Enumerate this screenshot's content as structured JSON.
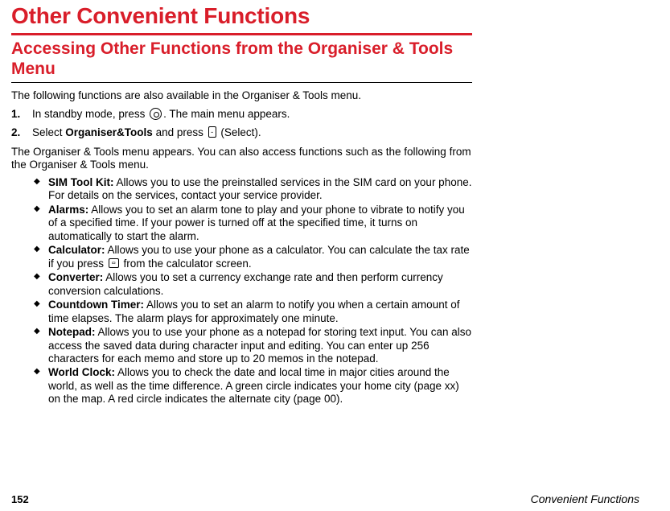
{
  "chapter_title": "Other Convenient Functions",
  "section_title": "Accessing Other Functions from the Organiser & Tools Menu",
  "intro": "The following functions are also available in the Organiser & Tools menu.",
  "steps": [
    {
      "num": "1.",
      "pre": "In standby mode, press ",
      "post": ". The main menu appears.",
      "icon": "circle"
    },
    {
      "num": "2.",
      "pre": "Select ",
      "bold": "Organiser&Tools",
      "mid": " and press ",
      "post": " (Select).",
      "icon": "rect"
    }
  ],
  "para": "The Organiser & Tools menu appears. You can also access functions such as the following from the Organiser & Tools menu.",
  "bullets": [
    {
      "label": "SIM Tool Kit:",
      "text": " Allows you to use the preinstalled services in the SIM card on your phone. For details on the services, contact your service provider."
    },
    {
      "label": "Alarms:",
      "text": " Allows you to set an alarm tone to play and your phone to vibrate to notify you of a specified time. If your power is turned off at the specified time, it turns on automatically to start the alarm."
    },
    {
      "label": "Calculator:",
      "text_pre": " Allows you to use your phone as a calculator. You can calculate the tax rate if you press ",
      "text_post": " from the calculator screen.",
      "has_key": true
    },
    {
      "label": "Converter:",
      "text": " Allows you to set a currency exchange rate and then perform currency conversion calculations."
    },
    {
      "label": "Countdown Timer:",
      "text": " Allows you to set an alarm to notify you when a certain amount of time elapses. The alarm plays for approximately one minute."
    },
    {
      "label": "Notepad:",
      "text": " Allows you to use your phone as a notepad for storing text input. You can also access the saved data during character input and editing. You can enter up 256 characters for each memo and store up to 20 memos in the notepad."
    },
    {
      "label": "World Clock:",
      "text": " Allows you to check the date and local time in major cities around the world, as well as the time difference. A green circle indicates your home city (page xx) on the map. A red circle indicates the alternate city (page 00)."
    }
  ],
  "footer": {
    "page": "152",
    "title": "Convenient Functions"
  }
}
